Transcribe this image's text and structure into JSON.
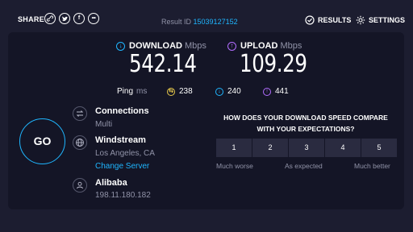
{
  "topbar": {
    "share_label": "SHARE",
    "share_icons": [
      "link-icon",
      "twitter-icon",
      "facebook-icon",
      "more-icon"
    ],
    "result_label": "Result ID",
    "result_id": "15039127152",
    "results_label": "RESULTS",
    "settings_label": "SETTINGS"
  },
  "download": {
    "label": "DOWNLOAD",
    "unit": "Mbps",
    "value": "542.14",
    "color": "#1fb6ff"
  },
  "upload": {
    "label": "UPLOAD",
    "unit": "Mbps",
    "value": "109.29",
    "color": "#b26dff"
  },
  "ping": {
    "label": "Ping",
    "unit": "ms",
    "idle": "238",
    "download": "240",
    "upload": "441",
    "idle_color": "#e6c84a"
  },
  "go_label": "GO",
  "connections": {
    "title": "Connections",
    "value": "Multi"
  },
  "server": {
    "title": "Windstream",
    "location": "Los Angeles, CA",
    "change_label": "Change Server"
  },
  "provider": {
    "title": "Alibaba",
    "ip": "198.11.180.182"
  },
  "survey": {
    "question": "HOW DOES YOUR DOWNLOAD SPEED COMPARE WITH YOUR EXPECTATIONS?",
    "options": [
      "1",
      "2",
      "3",
      "4",
      "5"
    ],
    "low_label": "Much worse",
    "mid_label": "As expected",
    "high_label": "Much better"
  }
}
